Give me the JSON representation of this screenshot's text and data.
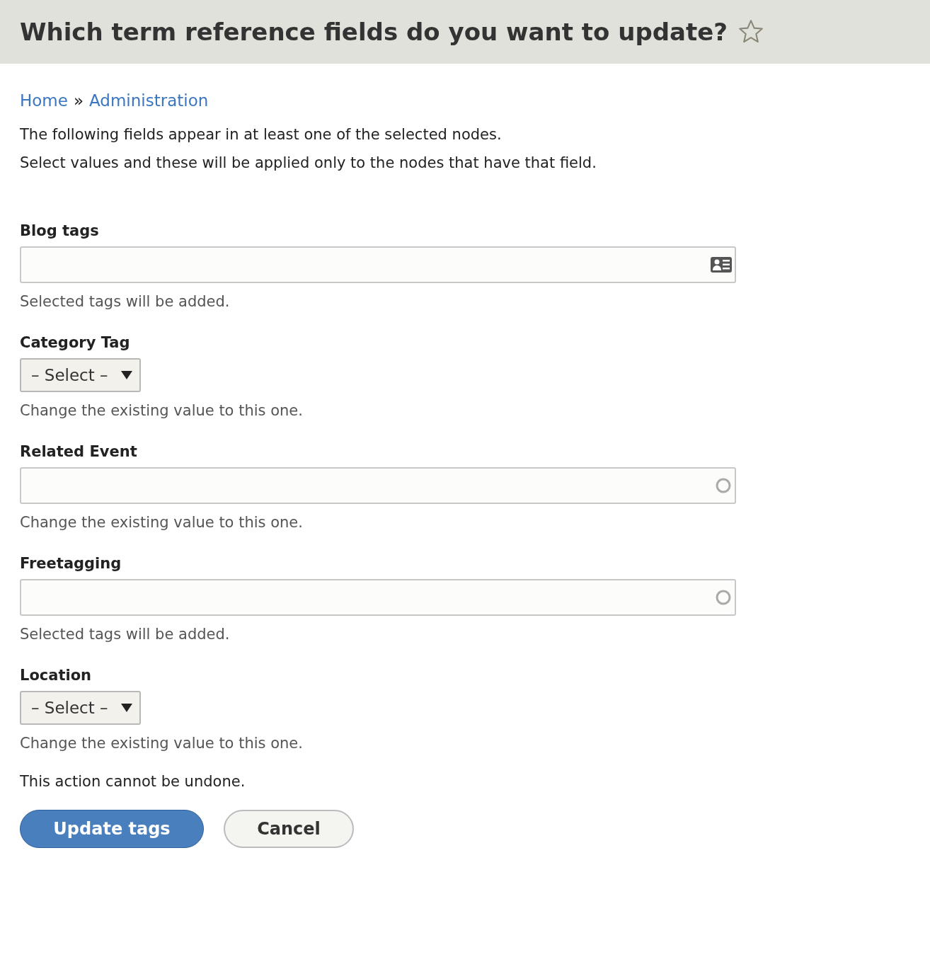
{
  "page_title": "Which term reference fields do you want to update?",
  "breadcrumb": [
    {
      "label": "Home"
    },
    {
      "label": "Administration"
    }
  ],
  "breadcrumb_separator": "»",
  "intro": [
    "The following fields appear in at least one of the selected nodes.",
    "Select values and these will be applied only to the nodes that have that field."
  ],
  "fields": [
    {
      "kind": "tags",
      "label": "Blog tags",
      "description": "Selected tags will be added."
    },
    {
      "kind": "select",
      "label": "Category Tag",
      "value": "– Select –",
      "description": "Change the existing value to this one."
    },
    {
      "kind": "autocomplete",
      "label": "Related Event",
      "description": "Change the existing value to this one."
    },
    {
      "kind": "autocomplete",
      "label": "Freetagging",
      "description": "Selected tags will be added."
    },
    {
      "kind": "select",
      "label": "Location",
      "value": "– Select –",
      "description": "Change the existing value to this one."
    }
  ],
  "warning": "This action cannot be undone.",
  "buttons": [
    {
      "kind": "primary",
      "label": "Update tags"
    },
    {
      "kind": "secondary",
      "label": "Cancel"
    }
  ]
}
